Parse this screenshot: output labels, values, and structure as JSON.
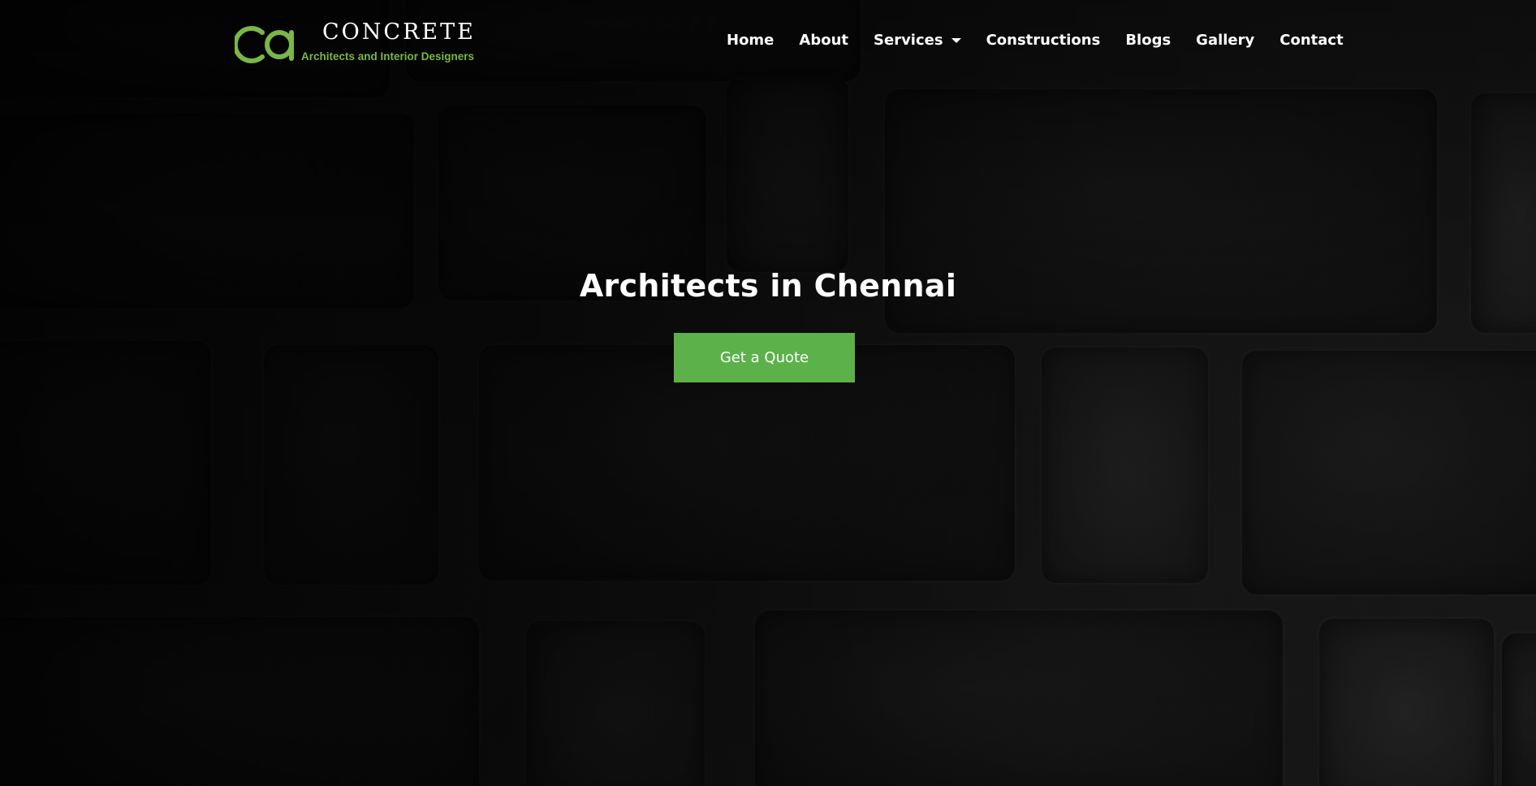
{
  "brand": {
    "title": "CONCRETE",
    "subtitle": "Architects and Interior Designers",
    "mark_text": "Ca",
    "accent_color": "#7ab648"
  },
  "nav": {
    "items": [
      {
        "label": "Home"
      },
      {
        "label": "About"
      },
      {
        "label": "Services",
        "has_dropdown": true
      },
      {
        "label": "Constructions"
      },
      {
        "label": "Blogs"
      },
      {
        "label": "Gallery"
      },
      {
        "label": "Contact"
      }
    ]
  },
  "hero": {
    "title": "Architects in Chennai",
    "cta_label": "Get a Quote",
    "cta_color": "#5cb14a"
  },
  "background": {
    "description_icon": "brick-wall-background"
  }
}
